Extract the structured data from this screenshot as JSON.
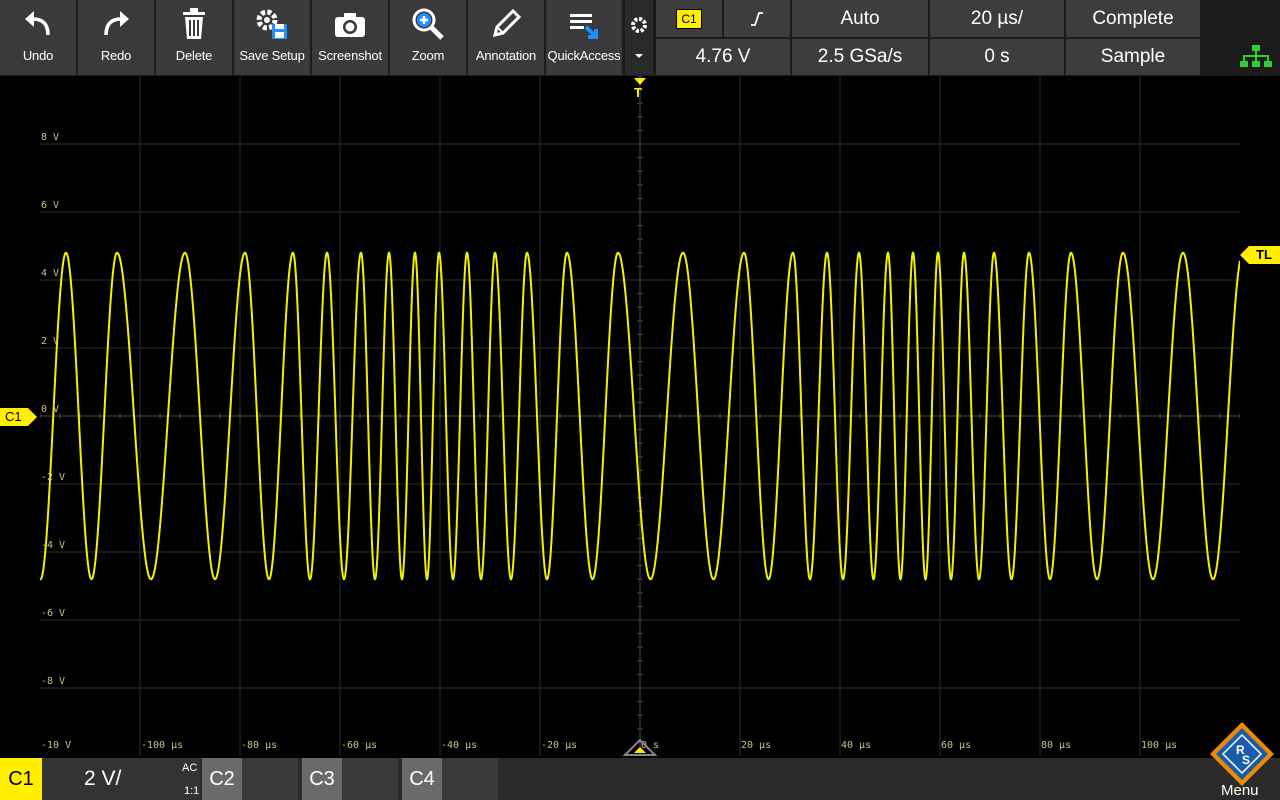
{
  "toolbar": {
    "buttons": [
      {
        "label": "Undo",
        "icon": "undo-icon"
      },
      {
        "label": "Redo",
        "icon": "redo-icon"
      },
      {
        "label": "Delete",
        "icon": "trash-icon"
      },
      {
        "label": "Save Setup",
        "icon": "save-setup-icon"
      },
      {
        "label": "Screenshot",
        "icon": "camera-icon"
      },
      {
        "label": "Zoom",
        "icon": "zoom-icon"
      },
      {
        "label": "Annotation",
        "icon": "pencil-icon"
      },
      {
        "label": "QuickAccess",
        "icon": "quick-access-icon"
      }
    ],
    "trigger": {
      "source": "C1",
      "slope_icon": "rising-edge-icon",
      "mode": "Auto",
      "level": "4.76 V"
    },
    "horizontal": {
      "timebase": "20 µs/",
      "sample_rate": "2.5 GSa/s",
      "offset": "0 s"
    },
    "acquisition": {
      "state": "Complete",
      "mode": "Sample"
    }
  },
  "plot": {
    "y_labels": [
      "8 V",
      "6 V",
      "4 V",
      "2 V",
      "0 V",
      "-2 V",
      "-4 V",
      "-6 V",
      "-8 V"
    ],
    "x_labels": [
      "-10 V",
      "-100 µs",
      "-80 µs",
      "-60 µs",
      "-40 µs",
      "-20 µs",
      "0 s",
      "20 µs",
      "40 µs",
      "60 µs",
      "80 µs",
      "100 µs"
    ],
    "channel_marker": "C1",
    "trigger_level_marker": "TL",
    "trigger_position_marker": "T"
  },
  "bottom": {
    "active_channel": {
      "name": "C1",
      "scale": "2 V/",
      "coupling": "AC",
      "probe": "1:1"
    },
    "channels": [
      "C2",
      "C3",
      "C4"
    ],
    "menu_label": "Menu"
  },
  "colors": {
    "trace": "#f5f000",
    "accent_yellow": "#ffee00",
    "grid": "#2e2e2e",
    "toolbar_bg": "#3a3a3a",
    "network_green": "#2fd12f",
    "brand_blue": "#1a5dad",
    "brand_orange": "#f08a00"
  },
  "chart_data": {
    "type": "line",
    "title": "",
    "xlabel": "",
    "ylabel": "",
    "xlim": [
      -120,
      120
    ],
    "ylim": [
      -10,
      10
    ],
    "x_unit": "µs",
    "y_unit": "V",
    "series": [
      {
        "amplitude": 4.8,
        "peak_times": [
          -114.8,
          -104.6,
          -91.0,
          -79.0,
          -69.4,
          -62.6,
          -55.8,
          -50.2,
          -45.0,
          -40.2,
          -34.6,
          -29.0,
          -22.6,
          -14.6,
          -4.4,
          8.6,
          20.8,
          30.6,
          37.4,
          43.8,
          49.6,
          54.6,
          59.6,
          64.8,
          70.8,
          77.8,
          86.2,
          96.6,
          108.6
        ]
      }
    ]
  }
}
